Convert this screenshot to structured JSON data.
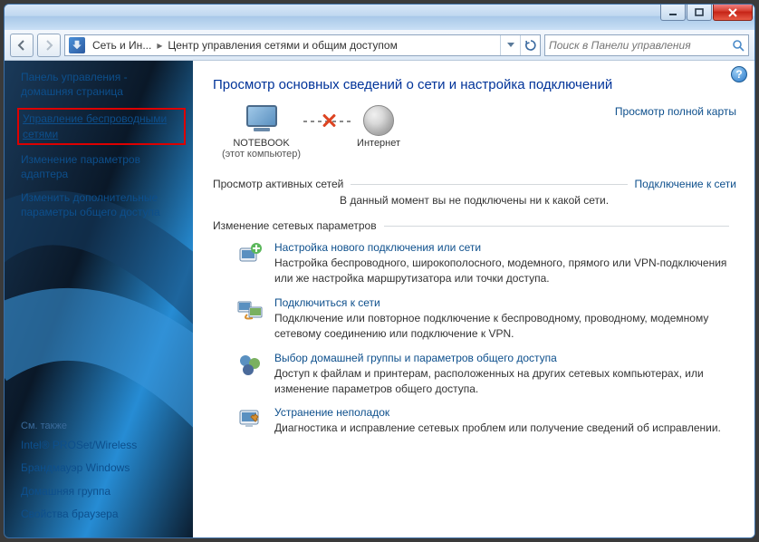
{
  "address": {
    "segment1": "Сеть и Ин...",
    "segment2": "Центр управления сетями и общим доступом"
  },
  "search": {
    "placeholder": "Поиск в Панели управления"
  },
  "sidebar": {
    "home": "Панель управления - домашняя страница",
    "links": [
      "Управление беспроводными сетями",
      "Изменение параметров адаптера",
      "Изменить дополнительные параметры общего доступа"
    ],
    "see_also_title": "См. также",
    "see_also": [
      "Intel® PROSet/Wireless",
      "Брандмауэр Windows",
      "Домашняя группа",
      "Свойства браузера"
    ]
  },
  "main": {
    "heading": "Просмотр основных сведений о сети и настройка подключений",
    "full_map": "Просмотр полной карты",
    "node_computer": "NOTEBOOK",
    "node_computer_sub": "(этот компьютер)",
    "node_internet": "Интернет",
    "active_nets_title": "Просмотр активных сетей",
    "connect_link": "Подключение к сети",
    "no_nets": "В данный момент вы не подключены ни к какой сети.",
    "change_params_title": "Изменение сетевых параметров",
    "actions": [
      {
        "title": "Настройка нового подключения или сети",
        "desc": "Настройка беспроводного, широкополосного, модемного, прямого или VPN-подключения или же настройка маршрутизатора или точки доступа."
      },
      {
        "title": "Подключиться к сети",
        "desc": "Подключение или повторное подключение к беспроводному, проводному, модемному сетевому соединению или подключение к VPN."
      },
      {
        "title": "Выбор домашней группы и параметров общего доступа",
        "desc": "Доступ к файлам и принтерам, расположенных на других сетевых компьютерах, или изменение параметров общего доступа."
      },
      {
        "title": "Устранение неполадок",
        "desc": "Диагностика и исправление сетевых проблем или получение сведений об исправлении."
      }
    ]
  }
}
